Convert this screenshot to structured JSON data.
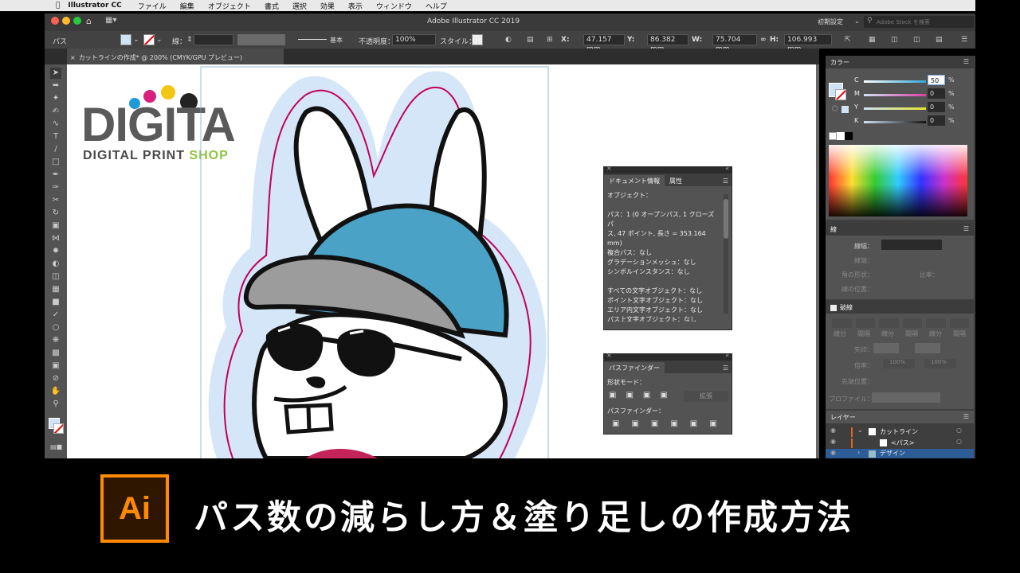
{
  "menubar": {
    "app": "Illustrator CC",
    "items": [
      "ファイル",
      "編集",
      "オブジェクト",
      "書式",
      "選択",
      "効果",
      "表示",
      "ウィンドウ",
      "ヘルプ"
    ]
  },
  "titlebar": {
    "title": "Adobe Illustrator CC 2019",
    "workspace": "初期設定",
    "search_placeholder": "Adobe Stock を検索"
  },
  "controlbar": {
    "mode": "パス",
    "stroke_label": "線：",
    "brush_label": "基本",
    "opacity_label": "不透明度：",
    "opacity_value": "100%",
    "style_label": "スタイル：",
    "x_label": "X:",
    "x_value": "47.157 mm",
    "y_label": "Y:",
    "y_value": "86.382 mm",
    "w_label": "W:",
    "w_value": "75.704 mm",
    "h_label": "H:",
    "h_value": "106.993 mm"
  },
  "doctab": {
    "label": "カットラインの作成* @ 200% (CMYK/GPU プレビュー)"
  },
  "logo": {
    "big": "DIGITA",
    "small": "DIGITAL PRINT",
    "shop": "SHOP"
  },
  "docinfo": {
    "tabs": [
      "ドキュメント情報",
      "属性"
    ],
    "lines": [
      "オブジェクト：",
      "",
      "パス：1 (0 オープンパス, 1 クローズパ",
      "ス, 47 ポイント, 長さ = 353.164",
      "mm)",
      "複合パス：なし",
      "グラデーションメッシュ：なし",
      "シンボルインスタンス：なし",
      "",
      "すべての文字オブジェクト：なし",
      "ポイント文字オブジェクト：なし",
      "エリア内文字オブジェクト：なし",
      "パス上文字オブジェクト：なし"
    ]
  },
  "pathfinder": {
    "title": "パスファインダー",
    "shape_modes": "形状モード：",
    "expand": "拡張",
    "pathfinders": "パスファインダー："
  },
  "color_panel": {
    "title": "カラー",
    "channels": [
      {
        "label": "C",
        "value": "50",
        "color": "#2fa9d8"
      },
      {
        "label": "M",
        "value": "0",
        "color": "#d83fa4"
      },
      {
        "label": "Y",
        "value": "0",
        "color": "#e5e52e"
      },
      {
        "label": "K",
        "value": "0",
        "color": "#6e6e6e"
      }
    ],
    "percent": "%"
  },
  "stroke_panel": {
    "title": "線",
    "weight": "線幅：",
    "cap": "線端：",
    "corner": "角の形状：",
    "ratio": "比率：",
    "align": "線の位置："
  },
  "dash_panel": {
    "title": "破線",
    "labels": [
      "線分",
      "間隔",
      "線分",
      "間隔",
      "線分",
      "間隔"
    ],
    "arrow": "矢印：",
    "scale": "倍率：",
    "scale_value1": "100%",
    "scale_value2": "100%",
    "pos": "先端位置：",
    "profile": "プロファイル："
  },
  "layers_panel": {
    "title": "レイヤー",
    "rows": [
      {
        "name": "カットライン"
      },
      {
        "name": "<パス>"
      },
      {
        "name": "デザイン"
      }
    ]
  },
  "banner": {
    "logo": "Ai",
    "title": "パス数の減らし方＆塗り足しの作成方法"
  },
  "colors": {
    "ai_orange": "#ff8a00",
    "cap_blue": "#4aa3c7",
    "cut_line": "#c4005a",
    "bleed_blue": "#d4e6f7"
  }
}
